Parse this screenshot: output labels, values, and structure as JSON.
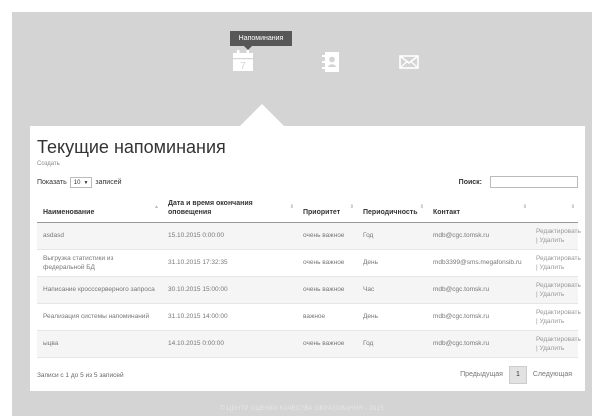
{
  "nav": {
    "tooltip": "Напоминания",
    "icons": [
      "calendar-icon",
      "contacts-icon",
      "mail-icon"
    ]
  },
  "page": {
    "title": "Текущие напоминания",
    "create_link": "Создать",
    "show_label": "Показать",
    "show_value": "10",
    "records_label": "записей",
    "search_label": "Поиск:",
    "search_value": ""
  },
  "table": {
    "columns": [
      "Наименование",
      "Дата и время окончания оповещения",
      "Приоритет",
      "Периодичность",
      "Контакт",
      ""
    ],
    "rows": [
      {
        "name": "asdasd",
        "date": "15.10.2015 0:00:00",
        "priority": "очень важное",
        "period": "Год",
        "contact": "mdb@cgc.tomsk.ru",
        "actions": "Редактировать | Удалить"
      },
      {
        "name": "Выгрузка статистики из федеральной БД",
        "date": "31.10.2015 17:32:35",
        "priority": "очень важное",
        "period": "День",
        "contact": "mdb3399@sms.megafonsib.ru",
        "actions": "Редактировать | Удалить"
      },
      {
        "name": "Написание кросссерверного запроса",
        "date": "30.10.2015 15:00:00",
        "priority": "очень важное",
        "period": "Час",
        "contact": "mdb@cgc.tomsk.ru",
        "actions": "Редактировать | Удалить"
      },
      {
        "name": "Реализация системы напоминаний",
        "date": "31.10.2015 14:00:00",
        "priority": "важное",
        "period": "День",
        "contact": "mdb@cgc.tomsk.ru",
        "actions": "Редактировать | Удалить"
      },
      {
        "name": "ыцва",
        "date": "14.10.2015 0:00:00",
        "priority": "очень важное",
        "period": "Год",
        "contact": "mdb@cgc.tomsk.ru",
        "actions": "Редактировать | Удалить"
      }
    ]
  },
  "info": "Записи с 1 до 5 из 5 записей",
  "pager": {
    "prev": "Предыдущая",
    "current": "1",
    "next": "Следующая"
  },
  "footer": "© ЦЕНТР ОЦЕНКИ КАЧЕСТВА ОБРАЗОВАНИЯ - 2015"
}
